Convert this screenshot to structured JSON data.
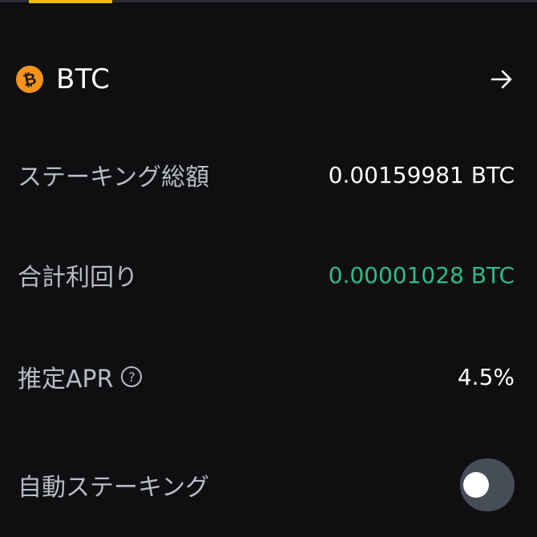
{
  "asset": {
    "symbol": "BTC",
    "logo_glyph": "₿",
    "logo_color": "#f7931a"
  },
  "details": {
    "total_staking": {
      "label": "ステーキング総額",
      "value": "0.00159981 BTC"
    },
    "total_rewards": {
      "label": "合計利回り",
      "value": "0.00001028 BTC",
      "value_color": "#2ebd85"
    },
    "estimated_apr": {
      "label": "推定APR",
      "help_glyph": "?",
      "value": "4.5%"
    },
    "auto_staking": {
      "label": "自動ステーキング",
      "enabled": false
    }
  },
  "icons": {
    "navigate": "arrow-right-icon",
    "help": "question-circle-icon"
  },
  "colors": {
    "background": "#0f0f12",
    "accent": "#f0b90b",
    "label_text": "#b7bdc6",
    "positive": "#2ebd85",
    "toggle_off": "#474d57"
  }
}
